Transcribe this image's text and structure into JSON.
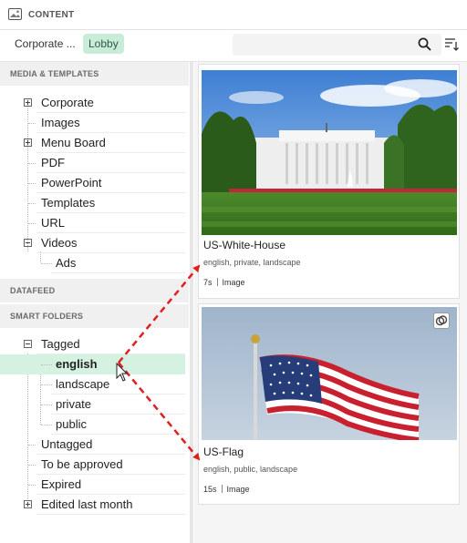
{
  "header": {
    "title": "CONTENT",
    "icon": "image-gallery-icon"
  },
  "tabs": [
    {
      "label": "Corporate ...",
      "active": false
    },
    {
      "label": "Lobby",
      "active": true
    }
  ],
  "search": {
    "placeholder": "",
    "value": ""
  },
  "sidebar": {
    "media_header": "MEDIA & TEMPLATES",
    "media_items": [
      "Corporate",
      "Images",
      "Menu Board",
      "PDF",
      "PowerPoint",
      "Templates",
      "URL",
      "Videos",
      "Ads"
    ],
    "datafeed_header": "DATAFEED",
    "smart_header": "SMART FOLDERS",
    "smart_items": [
      "Tagged",
      "english",
      "landscape",
      "private",
      "public",
      "Untagged",
      "To be approved",
      "Expired",
      "Edited last month"
    ]
  },
  "cards": [
    {
      "title": "US-White-House",
      "tags": "english, private, landscape",
      "duration": "7s",
      "type": "Image"
    },
    {
      "title": "US-Flag",
      "tags": "english, public, landscape",
      "duration": "15s",
      "type": "Image"
    }
  ],
  "colors": {
    "accent": "#c9ecd8",
    "selected": "#d5f1e1",
    "arrow": "#e02020"
  }
}
